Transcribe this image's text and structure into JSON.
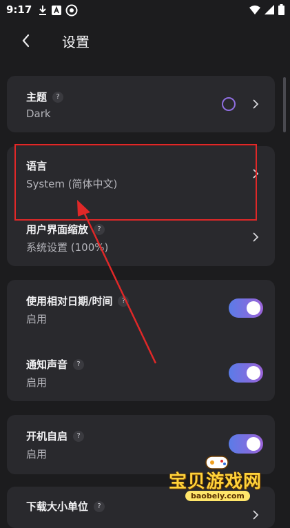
{
  "status_bar": {
    "time": "9:17",
    "left_icons": [
      "download-icon",
      "a-notification-icon",
      "app-notification-icon"
    ],
    "right_icons": [
      "wifi-icon",
      "cellular-icon",
      "battery-icon"
    ]
  },
  "header": {
    "title": "设置",
    "back_icon": "chevron-left-icon"
  },
  "settings": {
    "theme": {
      "title": "主题",
      "help": "?",
      "value": "Dark",
      "accent": "#8f6ee0"
    },
    "language": {
      "title": "语言",
      "value": "System (简体中文)"
    },
    "ui_scale": {
      "title": "用户界面缩放",
      "help": "?",
      "value": "系统设置 (100%)"
    },
    "relative_date": {
      "title": "使用相对日期/时间",
      "help": "?",
      "value": "启用",
      "enabled": true
    },
    "notification_sound": {
      "title": "通知声音",
      "help": "?",
      "value": "启用",
      "enabled": true
    },
    "autostart": {
      "title": "开机自启",
      "help": "?",
      "value": "启用",
      "enabled": true
    },
    "download_unit": {
      "title": "下载大小单位",
      "help": "?"
    }
  },
  "annotation": {
    "color": "#e02828"
  },
  "watermark": {
    "text": "宝贝游戏网",
    "url": "baobeiy.com"
  },
  "colors": {
    "background": "#1c1c1e",
    "card": "#29292d",
    "toggle_gradient_start": "#5a7ce8",
    "toggle_gradient_end": "#9a63d8"
  }
}
